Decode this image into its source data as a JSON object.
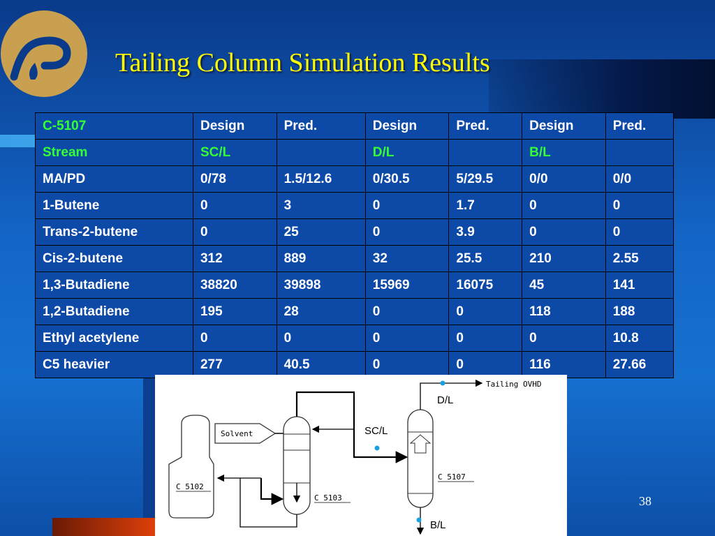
{
  "title": "Tailing Column Simulation Results",
  "slide_number": "38",
  "colors": {
    "title": "#ffff00",
    "header_green": "#33ff33",
    "table_bg": "#0d4aa8",
    "logo": "#c8a050"
  },
  "table": {
    "header": [
      "C-5107",
      "Design",
      "Pred.",
      "Design",
      "Pred.",
      "Design",
      "Pred."
    ],
    "stream_row": [
      "Stream",
      "SC/L",
      "",
      "D/L",
      "",
      "B/L",
      ""
    ],
    "rows": [
      [
        "MA/PD",
        "0/78",
        "1.5/12.6",
        "0/30.5",
        "5/29.5",
        "0/0",
        "0/0"
      ],
      [
        "1-Butene",
        "0",
        "3",
        "0",
        "1.7",
        "0",
        "0"
      ],
      [
        "Trans-2-butene",
        "0",
        "25",
        "0",
        "3.9",
        "0",
        "0"
      ],
      [
        "Cis-2-butene",
        "312",
        "889",
        "32",
        "25.5",
        "210",
        "2.55"
      ],
      [
        "1,3-Butadiene",
        "38820",
        "39898",
        "15969",
        "16075",
        "45",
        "141"
      ],
      [
        "1,2-Butadiene",
        "195",
        "28",
        "0",
        "0",
        "118",
        "188"
      ],
      [
        "Ethyl acetylene",
        "0",
        "0",
        "0",
        "0",
        "0",
        "10.8"
      ],
      [
        "C5 heavier",
        "277",
        "40.5",
        "0",
        "0",
        "116",
        "27.66"
      ]
    ]
  },
  "diagram": {
    "tailing_ovhd": "Tailing OVHD",
    "dl": "D/L",
    "scl": "SC/L",
    "bl": "B/L",
    "solvent": "Solvent",
    "c5102": "C 5102",
    "c5103": "C 5103",
    "c5107": "C 5107"
  }
}
